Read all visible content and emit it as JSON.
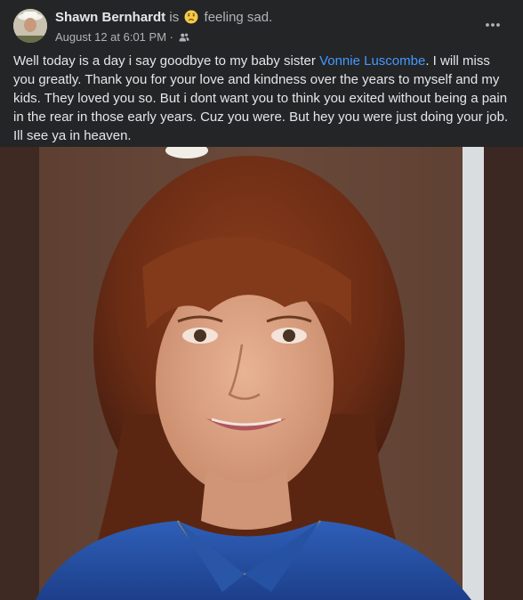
{
  "post": {
    "author": "Shawn Bernhardt",
    "is_word": "is",
    "feeling": "feeling sad.",
    "feeling_icon": "sad-face-emoji",
    "timestamp": "August 12 at 6:01 PM",
    "separator": "·",
    "audience_icon": "friends-icon",
    "text_before_mention": "Well today is a day i say goodbye to my baby sister ",
    "mention": "Vonnie Luscombe",
    "text_after_mention": ". I will miss you greatly. Thank you for your love and kindness over the years to myself and my kids. They loved you so. But i dont want you to think you exited without being a pain in the rear in those early years. Cuz you were. But hey you were just doing your job. Ill see ya in heaven.",
    "more_icon": "more-options-icon"
  },
  "colors": {
    "background": "#242526",
    "primary_text": "#e4e6eb",
    "secondary_text": "#b0b3b8",
    "mention": "#4599ff"
  }
}
